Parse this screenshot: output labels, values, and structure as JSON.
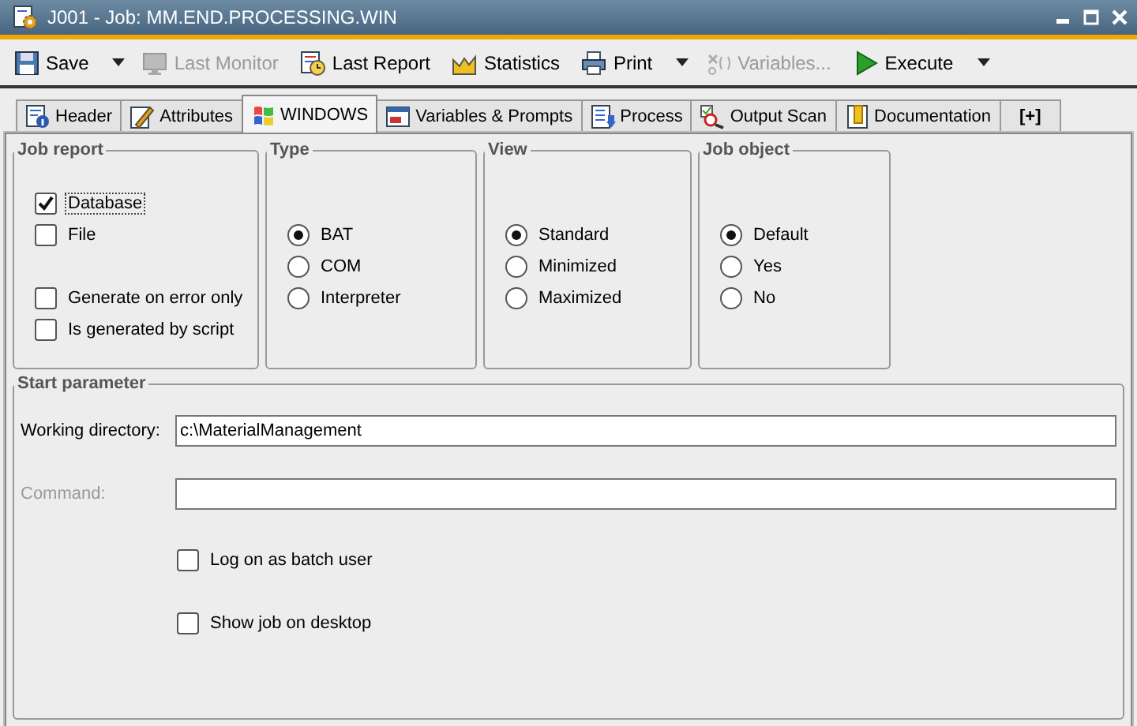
{
  "window": {
    "title": "J001 - Job: MM.END.PROCESSING.WIN"
  },
  "toolbar": [
    {
      "label": "Save",
      "disabled": false,
      "menu": true
    },
    {
      "label": "Last Monitor",
      "disabled": true,
      "menu": false
    },
    {
      "label": "Last Report",
      "disabled": false,
      "menu": false
    },
    {
      "label": "Statistics",
      "disabled": false,
      "menu": false
    },
    {
      "label": "Print",
      "disabled": false,
      "menu": true
    },
    {
      "label": "Variables...",
      "disabled": true,
      "menu": false
    },
    {
      "label": "Execute",
      "disabled": false,
      "menu": true
    }
  ],
  "tabs": [
    {
      "label": "Header",
      "selected": false
    },
    {
      "label": "Attributes",
      "selected": false
    },
    {
      "label": "WINDOWS",
      "selected": true
    },
    {
      "label": "Variables & Prompts",
      "selected": false
    },
    {
      "label": "Process",
      "selected": false
    },
    {
      "label": "Output Scan",
      "selected": false
    },
    {
      "label": "Documentation",
      "selected": false
    },
    {
      "label": "[+]",
      "selected": false
    }
  ],
  "groups": [
    {
      "title": "Job report",
      "kind": "checks",
      "items": [
        {
          "label": "Database",
          "checked": true,
          "focused": true
        },
        {
          "label": "File",
          "checked": false,
          "focused": false
        },
        {
          "label": "Generate on error only",
          "checked": false,
          "focused": false
        },
        {
          "label": "Is generated by script",
          "checked": false,
          "focused": false
        }
      ]
    },
    {
      "title": "Type",
      "kind": "radios",
      "items": [
        {
          "label": "BAT",
          "selected": true
        },
        {
          "label": "COM",
          "selected": false
        },
        {
          "label": "Interpreter",
          "selected": false
        }
      ]
    },
    {
      "title": "View",
      "kind": "radios",
      "items": [
        {
          "label": "Standard",
          "selected": true
        },
        {
          "label": "Minimized",
          "selected": false
        },
        {
          "label": "Maximized",
          "selected": false
        }
      ]
    },
    {
      "title": "Job object",
      "kind": "radios",
      "items": [
        {
          "label": "Default",
          "selected": true
        },
        {
          "label": "Yes",
          "selected": false
        },
        {
          "label": "No",
          "selected": false
        }
      ]
    }
  ],
  "start_parameter": {
    "title": "Start parameter",
    "fields": [
      {
        "label": "Working directory:",
        "value": "c:\\MaterialManagement",
        "disabled": false
      },
      {
        "label": "Command:",
        "disabled": true
      }
    ],
    "options": [
      {
        "label": "Log on as batch user",
        "checked": false
      },
      {
        "label": "Show job on desktop",
        "checked": false
      }
    ]
  }
}
